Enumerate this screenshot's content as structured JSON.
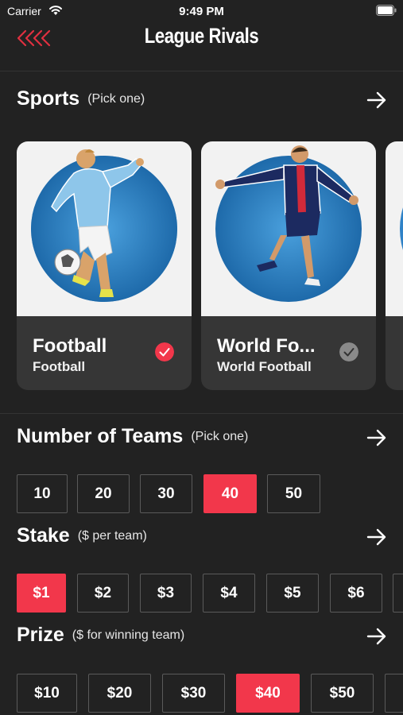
{
  "status_bar": {
    "carrier": "Carrier",
    "time": "9:49 PM"
  },
  "nav": {
    "title": "League Rivals",
    "back_icon": "triple-chevron-left-icon"
  },
  "colors": {
    "accent": "#f2374b",
    "background": "#222222",
    "card": "#363636"
  },
  "sports": {
    "title": "Sports",
    "hint": "(Pick one)",
    "items": [
      {
        "name": "Football",
        "subtitle": "Football",
        "selected": true
      },
      {
        "name": "World Fo...",
        "subtitle": "World Football",
        "selected": false
      }
    ]
  },
  "teams": {
    "title": "Number of Teams",
    "hint": "(Pick one)",
    "options": [
      "10",
      "20",
      "30",
      "40",
      "50"
    ],
    "selected": "40"
  },
  "stake": {
    "title": "Stake",
    "hint": "($ per team)",
    "options": [
      "$1",
      "$2",
      "$3",
      "$4",
      "$5",
      "$6"
    ],
    "selected": "$1"
  },
  "prize": {
    "title": "Prize",
    "hint": "($ for winning team)",
    "options": [
      "$10",
      "$20",
      "$30",
      "$40",
      "$50"
    ],
    "selected": "$40"
  }
}
